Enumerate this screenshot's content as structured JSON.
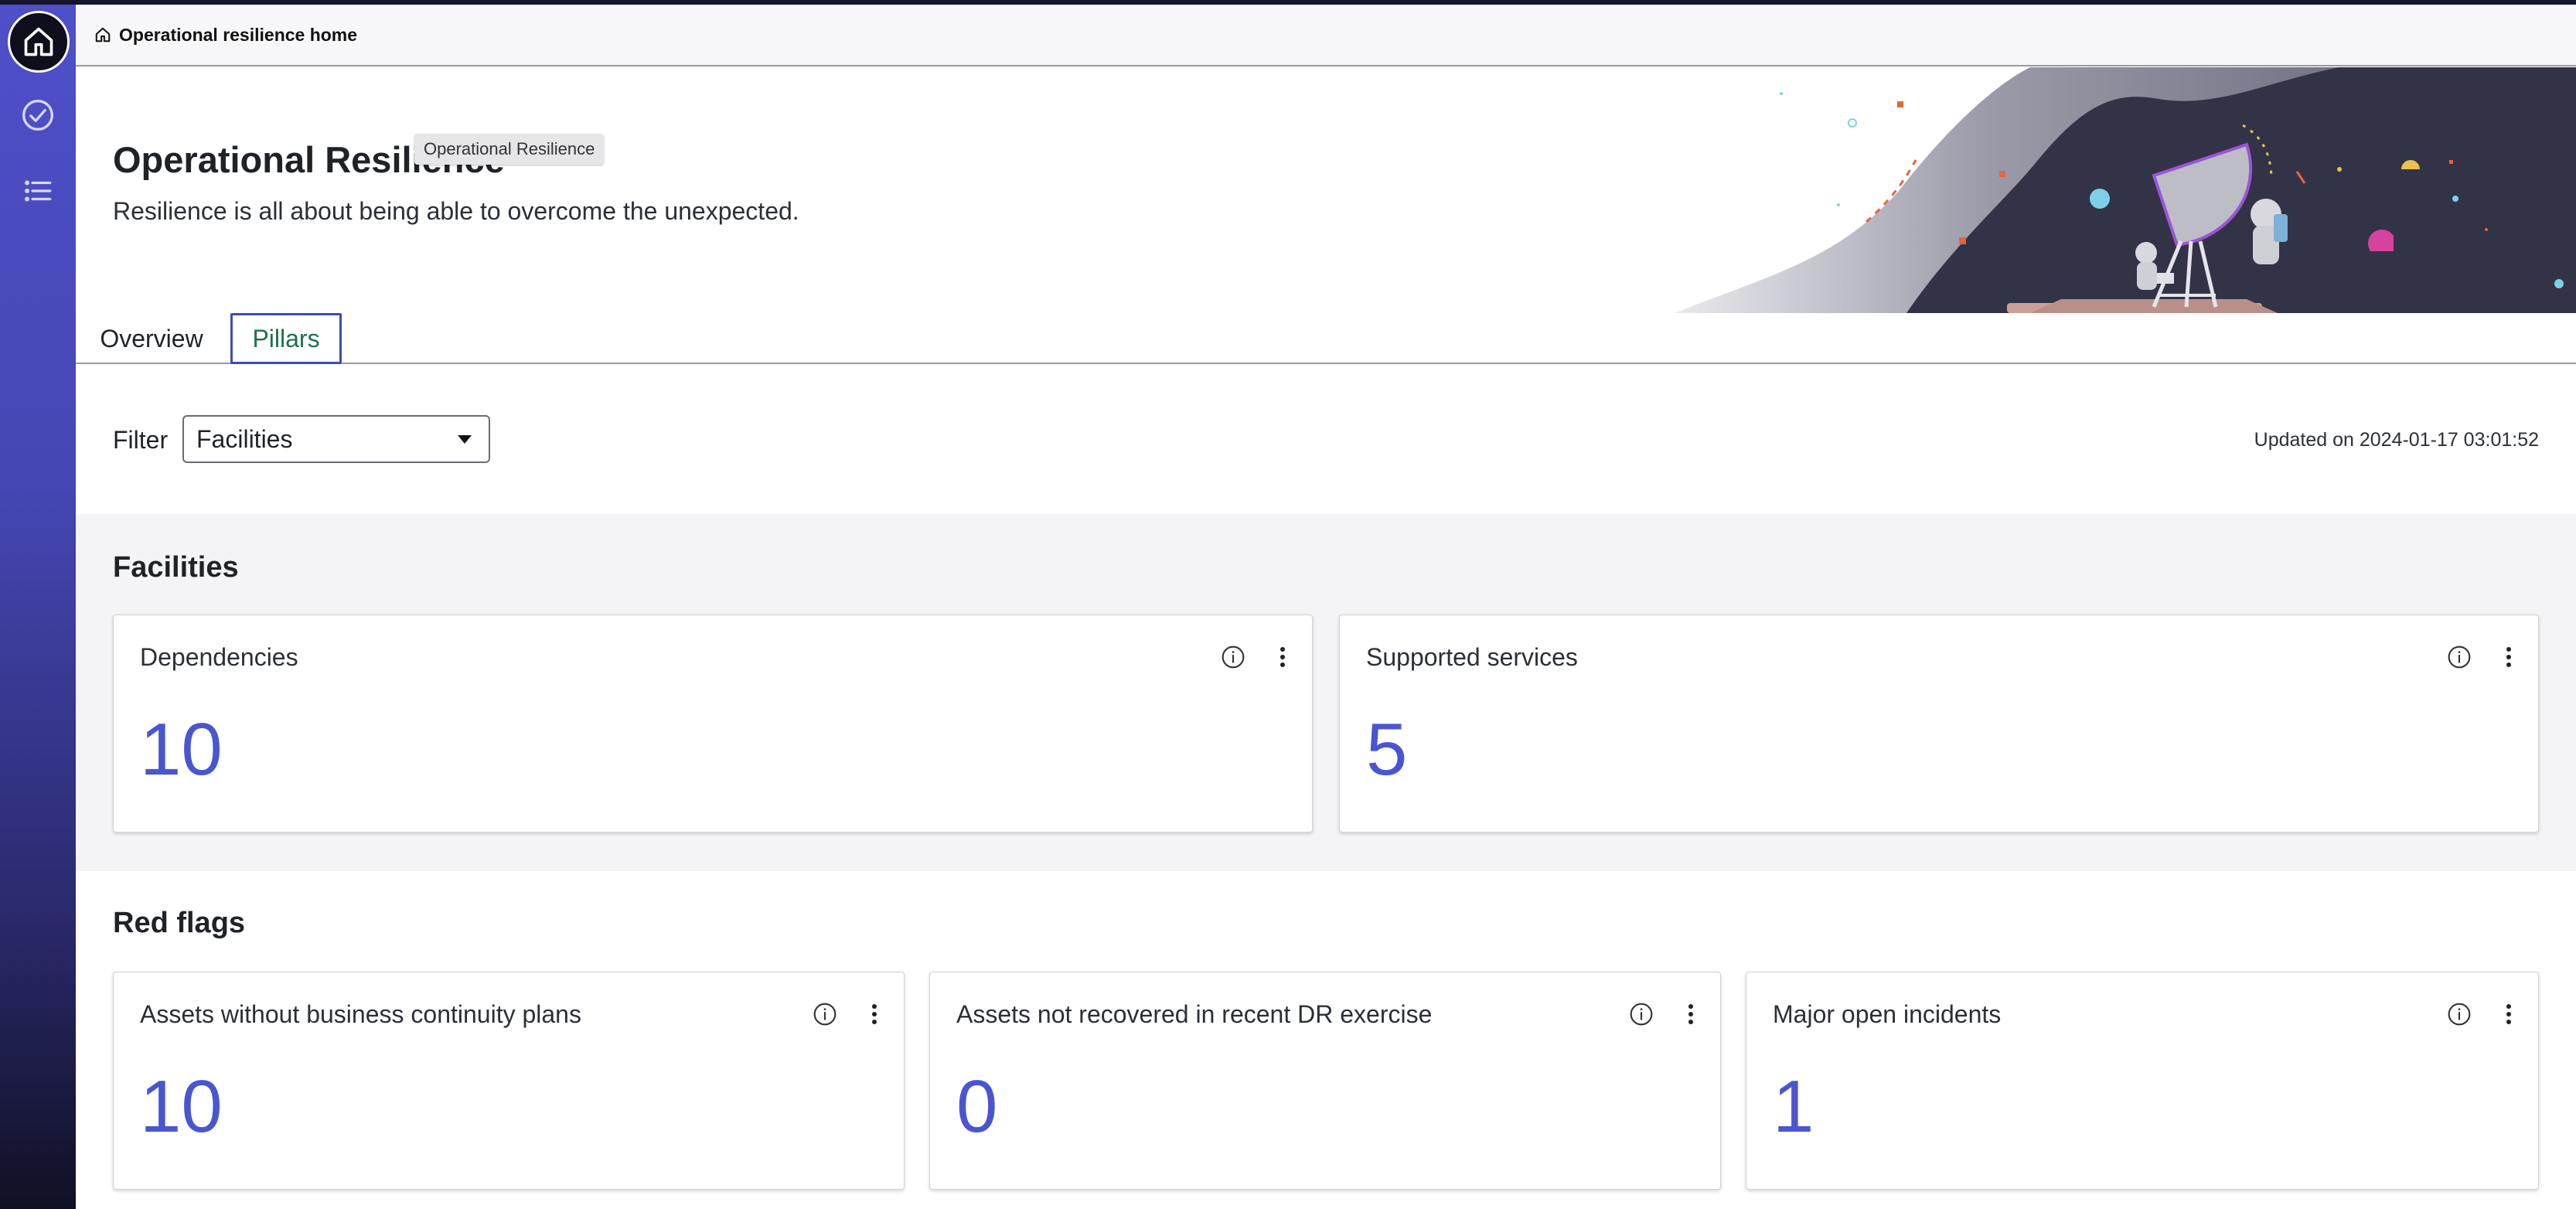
{
  "sidebar": {
    "items": [
      {
        "icon": "home-icon"
      },
      {
        "icon": "check-circle-icon"
      },
      {
        "icon": "list-icon"
      }
    ]
  },
  "header": {
    "breadcrumb": "Operational resilience home",
    "breadcrumb_icon": "home-icon"
  },
  "hero": {
    "title": "Operational Resilience",
    "subtitle": "Resilience is all about being able to overcome the unexpected.",
    "tooltip": "Operational Resilience"
  },
  "tabs": [
    {
      "label": "Overview",
      "active": false
    },
    {
      "label": "Pillars",
      "active": true
    }
  ],
  "filter": {
    "label": "Filter",
    "selected": "Facilities",
    "updated": "Updated on 2024-01-17 03:01:52"
  },
  "sections": {
    "facilities": {
      "title": "Facilities",
      "cards": [
        {
          "title": "Dependencies",
          "value": "10"
        },
        {
          "title": "Supported services",
          "value": "5"
        }
      ]
    },
    "red_flags": {
      "title": "Red flags",
      "cards": [
        {
          "title": "Assets without business continuity plans",
          "value": "10"
        },
        {
          "title": "Assets not recovered in recent DR exercise",
          "value": "0"
        },
        {
          "title": "Major open incidents",
          "value": "1"
        }
      ]
    }
  },
  "colors": {
    "accent": "#4a55cf",
    "sidebar_top": "#4f4fc9",
    "active_tab_text": "#1f6f4a",
    "active_tab_border": "#3b4db5"
  }
}
